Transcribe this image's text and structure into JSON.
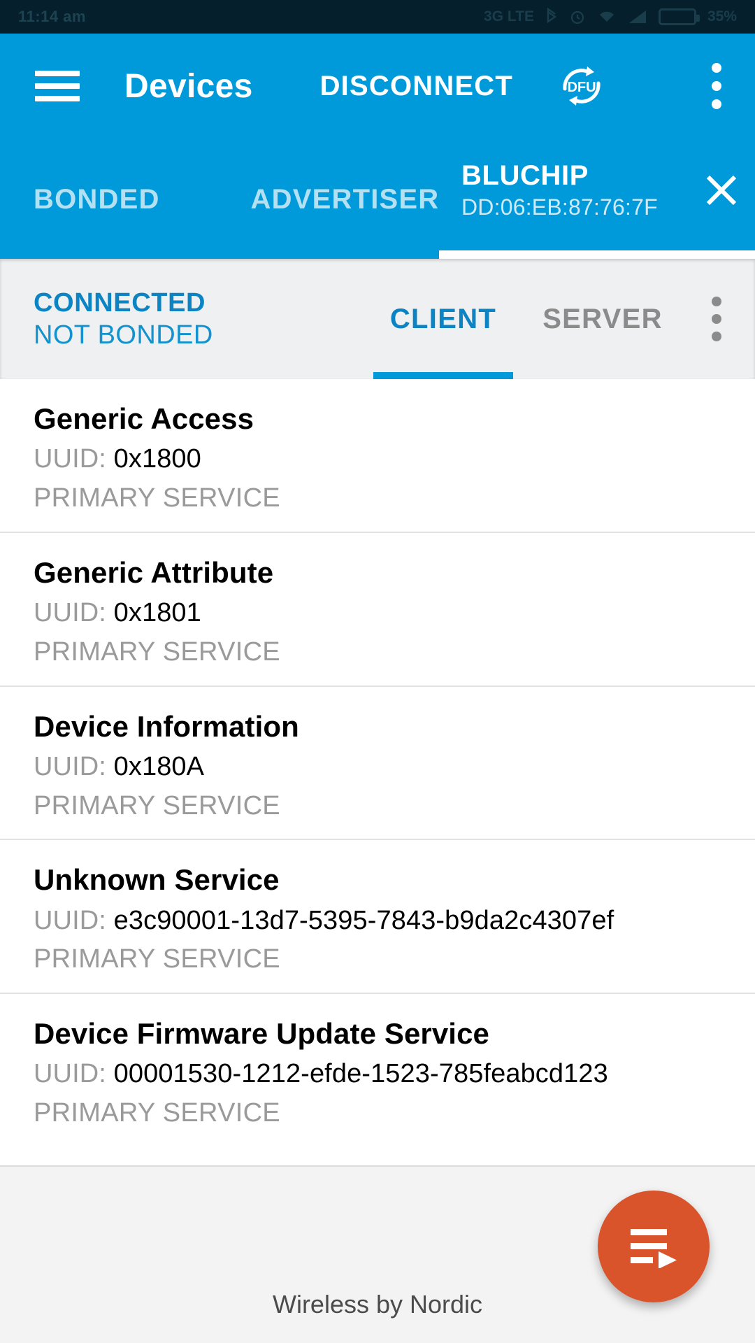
{
  "statusbar": {
    "clock": "11:14 am",
    "icons": [
      "bluetooth-icon",
      "alarm-icon",
      "wifi-icon",
      "signal-icon",
      "sim-icon",
      "battery-icon"
    ],
    "battery_percent": "35%",
    "network_label": "3G LTE"
  },
  "appbar": {
    "menu_icon": "hamburger-icon",
    "title": "Devices",
    "action_label": "DISCONNECT",
    "dfu_label": "DFU",
    "overflow_icon": "overflow-menu-icon"
  },
  "tabs": {
    "bonded": "BONDED",
    "advertiser": "ADVERTISER",
    "device": {
      "name": "BLUCHIP",
      "address": "DD:06:EB:87:76:7F",
      "close_icon": "close-icon"
    }
  },
  "connection": {
    "state": "CONNECTED",
    "bond": "NOT BONDED",
    "client_tab": "CLIENT",
    "server_tab": "SERVER",
    "overflow_icon": "overflow-menu-icon"
  },
  "services": [
    {
      "name": "Generic Access",
      "uuid_label": "UUID:",
      "uuid": "0x1800",
      "type": "PRIMARY SERVICE"
    },
    {
      "name": "Generic Attribute",
      "uuid_label": "UUID:",
      "uuid": "0x1801",
      "type": "PRIMARY SERVICE"
    },
    {
      "name": "Device Information",
      "uuid_label": "UUID:",
      "uuid": "0x180A",
      "type": "PRIMARY SERVICE"
    },
    {
      "name": "Unknown Service",
      "uuid_label": "UUID:",
      "uuid": "e3c90001-13d7-5395-7843-b9da2c4307ef",
      "type": "PRIMARY SERVICE"
    },
    {
      "name": "Device Firmware Update Service",
      "uuid_label": "UUID:",
      "uuid": "00001530-1212-efde-1523-785feabcd123",
      "type": "PRIMARY SERVICE"
    }
  ],
  "fab": {
    "icon": "playlist-play-icon"
  },
  "footer": {
    "text": "Wireless by Nordic"
  },
  "colors": {
    "brand_blue": "#009ADB",
    "status_blue": "#0c84c4",
    "fab_orange": "#d9542b",
    "muted_gray": "#9a9a9a",
    "surface_gray": "#f3f3f3",
    "subheader_gray": "#eef0f1",
    "statusbar_dark": "#05202c"
  }
}
